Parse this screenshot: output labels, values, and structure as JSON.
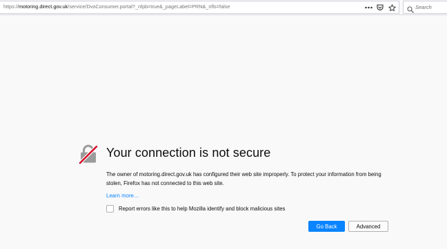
{
  "browser": {
    "url": {
      "prefix": "https://",
      "host": "motoring.direct.gov.uk",
      "path": "/service/DvoConsumer.portal?_nfpb=true&_pageLabel=PRN&_nfls=false"
    },
    "page_actions": [
      "more-actions-icon",
      "pocket-icon",
      "bookmark-star-icon"
    ],
    "search_placeholder": "Search"
  },
  "error_page": {
    "icon": "broken-lock-icon",
    "title": "Your connection is not secure",
    "description": "The owner of motoring.direct.gov.uk has configured their web site improperly. To protect your information from being stolen, Firefox has not connected to this web site.",
    "learn_more": "Learn more…",
    "report_checkbox_checked": false,
    "report_label": "Report errors like this to help Mozilla identify and block malicious sites",
    "buttons": {
      "go_back": "Go Back",
      "advanced": "Advanced"
    }
  },
  "colors": {
    "background": "#f9f9fa",
    "primary_button": "#0a84ff",
    "link": "#0a84ff",
    "lock_gray": "#9b9b9b",
    "lock_slash": "#d70022"
  }
}
